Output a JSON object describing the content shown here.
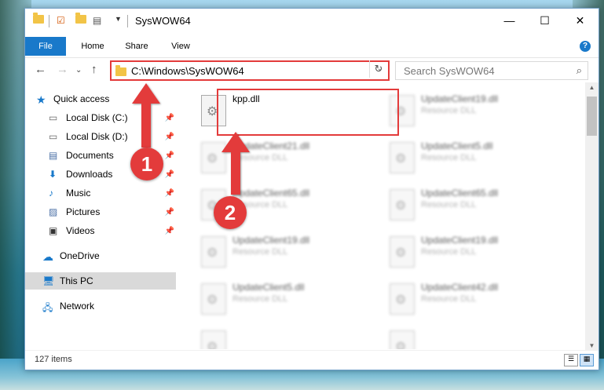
{
  "window": {
    "title": "SysWOW64",
    "controls": {
      "minimize": "—",
      "maximize": "☐",
      "close": "✕"
    }
  },
  "ribbon": {
    "tabs": [
      "File",
      "Home",
      "Share",
      "View"
    ],
    "help": "?"
  },
  "address": {
    "path": "C:\\Windows\\SysWOW64",
    "search_placeholder": "Search SysWOW64"
  },
  "nav": {
    "items": [
      {
        "label": "Quick access",
        "icon": "star-icon",
        "pinned": false
      },
      {
        "label": "Local Disk (C:)",
        "icon": "drive-icon",
        "pinned": true
      },
      {
        "label": "Local Disk (D:)",
        "icon": "drive-icon",
        "pinned": true
      },
      {
        "label": "Documents",
        "icon": "documents-icon",
        "pinned": true
      },
      {
        "label": "Downloads",
        "icon": "download-icon",
        "pinned": true
      },
      {
        "label": "Music",
        "icon": "music-icon",
        "pinned": true
      },
      {
        "label": "Pictures",
        "icon": "pictures-icon",
        "pinned": true
      },
      {
        "label": "Videos",
        "icon": "videos-icon",
        "pinned": true
      },
      {
        "label": "OneDrive",
        "icon": "cloud-icon",
        "pinned": false
      },
      {
        "label": "This PC",
        "icon": "computer-icon",
        "pinned": false,
        "selected": true
      },
      {
        "label": "Network",
        "icon": "network-icon",
        "pinned": false
      }
    ]
  },
  "files": [
    {
      "name": "kpp.dll",
      "type": ""
    },
    {
      "name": "UpdateClient19.dll",
      "type": "Resource DLL"
    },
    {
      "name": "UpdateClient21.dll",
      "type": "Resource DLL"
    },
    {
      "name": "UpdateClient5.dll",
      "type": "Resource DLL"
    },
    {
      "name": "UpdateClient65.dll",
      "type": "Resource DLL"
    },
    {
      "name": "UpdateClient65.dll",
      "type": "Resource DLL"
    },
    {
      "name": "UpdateClient19.dll",
      "type": "Resource DLL"
    },
    {
      "name": "UpdateClient19.dll",
      "type": "Resource DLL"
    },
    {
      "name": "UpdateClient5.dll",
      "type": "Resource DLL"
    },
    {
      "name": "UpdateClient42.dll",
      "type": "Resource DLL"
    }
  ],
  "status": {
    "count": "127 items"
  },
  "callouts": [
    "1",
    "2"
  ],
  "colors": {
    "accent": "#1979ca",
    "highlight": "#e33b3b",
    "selected_nav": "#d9d9d9"
  }
}
